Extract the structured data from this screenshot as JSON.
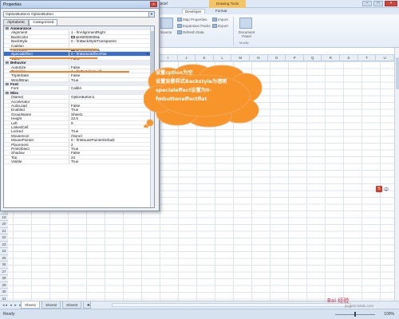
{
  "excel": {
    "title": "Book.xlsx - Microsoft Excel",
    "contextual_tab": "Drawing Tools",
    "window_buttons": [
      "–",
      "□",
      "×"
    ],
    "ribbon_tabs": [
      "Developer",
      "Format"
    ],
    "ribbon": {
      "source_label": "Source",
      "map_properties": "Map Properties",
      "expansion_packs": "Expansion Packs",
      "refresh_data": "Refresh Data",
      "import": "Import",
      "export": "Export",
      "document_panel": "Document Panel",
      "modify_label": "Modify"
    },
    "columns": [
      "I",
      "J",
      "K",
      "L",
      "M",
      "N",
      "O",
      "P",
      "Q",
      "R",
      "S",
      "T",
      "U"
    ],
    "rows": [
      "18",
      "19",
      "20",
      "21",
      "22",
      "23",
      "24",
      "25",
      "26",
      "27",
      "28",
      "29",
      "30",
      "31"
    ],
    "sheet_nav": "◂◂ ◂ ▸ ▸▸",
    "sheets": [
      "Sheet1",
      "Sheet2",
      "Sheet3"
    ],
    "status": "Ready",
    "zoom": "100%"
  },
  "properties": {
    "title": "Properties",
    "object": "OptionButton1 OptionButton",
    "tabs": [
      "Alphabetic",
      "Categorized"
    ],
    "active_tab": "Categorized",
    "rows": [
      {
        "type": "cat",
        "name": "Appearance"
      },
      {
        "name": "Alignment",
        "value": "1 - fmAlignmentRight"
      },
      {
        "name": "BackColor",
        "value": "&H80000005&",
        "swatch": "#ffffff"
      },
      {
        "name": "BackStyle",
        "value": "0 - fmBackStyleTransparent"
      },
      {
        "name": "Caption",
        "value": ""
      },
      {
        "name": "ForeColor",
        "value": "&H80000008&",
        "swatch": "#000000"
      },
      {
        "name": "SpecialEffect",
        "value": "0 - fmButtonEffectFlat",
        "selected": true
      },
      {
        "name": "Value",
        "value": "False"
      },
      {
        "type": "cat",
        "name": "Behavior"
      },
      {
        "name": "AutoSize",
        "value": "False"
      },
      {
        "name": "TextAlign",
        "value": "1 - fmTextAlignLeft"
      },
      {
        "name": "TripleState",
        "value": "False"
      },
      {
        "name": "WordWrap",
        "value": "True"
      },
      {
        "type": "cat",
        "name": "Font"
      },
      {
        "name": "Font",
        "value": "Calibri"
      },
      {
        "type": "cat",
        "name": "Misc"
      },
      {
        "name": "(Name)",
        "value": "OptionButton1"
      },
      {
        "name": "Accelerator",
        "value": ""
      },
      {
        "name": "AutoLoad",
        "value": "False"
      },
      {
        "name": "Enabled",
        "value": "True"
      },
      {
        "name": "GroupName",
        "value": "Sheet1"
      },
      {
        "name": "Height",
        "value": "22.5"
      },
      {
        "name": "Left",
        "value": "9"
      },
      {
        "name": "LinkedCell",
        "value": ""
      },
      {
        "name": "Locked",
        "value": "True"
      },
      {
        "name": "MouseIcon",
        "value": "(None)"
      },
      {
        "name": "MousePointer",
        "value": "0 - fmMousePointerDefault"
      },
      {
        "name": "Placement",
        "value": "2"
      },
      {
        "name": "PrintObject",
        "value": "True"
      },
      {
        "name": "Shadow",
        "value": "False"
      },
      {
        "name": "Top",
        "value": "24"
      },
      {
        "name": "Visible",
        "value": "True"
      }
    ]
  },
  "callout": {
    "lines": [
      "设置cption为空",
      "设置背景样式Backstyle为透明",
      "specialeffect设置为0-",
      "fmbuttoneffectflat"
    ],
    "fill": "#f7942a"
  },
  "watermark": {
    "main": "Bai 经验",
    "sub": "jingyan.baidu.com",
    "s_label": "S",
    "s_extra": "中"
  }
}
